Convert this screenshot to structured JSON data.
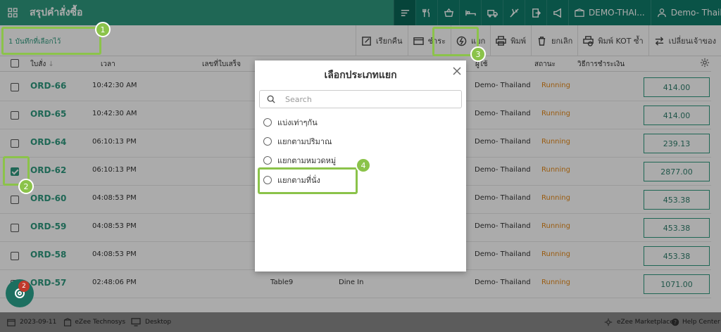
{
  "app": {
    "title": "สรุปคำสั่งซื้อ"
  },
  "topbar": {
    "property": "DEMO-THAI...",
    "user": "Demo- Thail..."
  },
  "toolbar": {
    "selected_count": "1 บันทึกที่เลือกไว้",
    "buttons": [
      "เรียกคืน",
      "ชำระ",
      "แยก",
      "พิมพ์",
      "ยกเลิก",
      "พิมพ์ KOT ซ้ำ",
      "เปลี่ยนเจ้าของ"
    ]
  },
  "table": {
    "headers": {
      "order": "ใบสั่ง",
      "time": "เวลา",
      "receipt": "เลขที่ใบเสร็จ",
      "user": "ผู้ใช้",
      "status": "สถานะ",
      "payment": "วิธีการชำระเงิน"
    },
    "rows": [
      {
        "id": "ORD-66",
        "time": "10:42:30 AM",
        "table": "",
        "type": "",
        "user": "Demo- Thailand",
        "status": "Running",
        "amount": "414.00",
        "checked": false
      },
      {
        "id": "ORD-65",
        "time": "10:42:30 AM",
        "table": "",
        "type": "",
        "user": "Demo- Thailand",
        "status": "Running",
        "amount": "414.00",
        "checked": false
      },
      {
        "id": "ORD-64",
        "time": "06:10:13 PM",
        "table": "",
        "type": "",
        "user": "Demo- Thailand",
        "status": "Running",
        "amount": "239.13",
        "checked": false
      },
      {
        "id": "ORD-62",
        "time": "06:10:13 PM",
        "table": "",
        "type": "",
        "user": "Demo- Thailand",
        "status": "Running",
        "amount": "2877.00",
        "checked": true
      },
      {
        "id": "ORD-60",
        "time": "04:08:53 PM",
        "table": "",
        "type": "",
        "user": "Demo- Thailand",
        "status": "Running",
        "amount": "453.38",
        "checked": false
      },
      {
        "id": "ORD-59",
        "time": "04:08:53 PM",
        "table": "",
        "type": "",
        "user": "Demo- Thailand",
        "status": "Running",
        "amount": "453.38",
        "checked": false
      },
      {
        "id": "ORD-58",
        "time": "04:08:53 PM",
        "table": "",
        "type": "",
        "user": "Demo- Thailand",
        "status": "Running",
        "amount": "453.38",
        "checked": false
      },
      {
        "id": "ORD-57",
        "time": "02:48:06 PM",
        "table": "Table9",
        "type": "Dine In",
        "user": "Demo- Thailand",
        "status": "Running",
        "amount": "1071.00",
        "checked": false
      }
    ]
  },
  "dialog": {
    "title": "เลือกประเภทแยก",
    "search_placeholder": "Search",
    "options": [
      "แบ่งเท่าๆกัน",
      "แยกตามปริมาณ",
      "แยกตามหมวดหมู่",
      "แยกตามที่นั่ง"
    ]
  },
  "footer": {
    "date": "2023-09-11",
    "company": "eZee Technosys",
    "device": "Desktop",
    "marketplace": "eZee Marketplace",
    "help": "Help Center"
  },
  "fab": {
    "count": "2"
  },
  "callouts": [
    "1",
    "2",
    "3",
    "4"
  ],
  "colors": {
    "brand": "#2f9a7f",
    "brand_dark": "#0f7c6a",
    "status": "#e68a1a",
    "highlight": "#8bc34a"
  }
}
